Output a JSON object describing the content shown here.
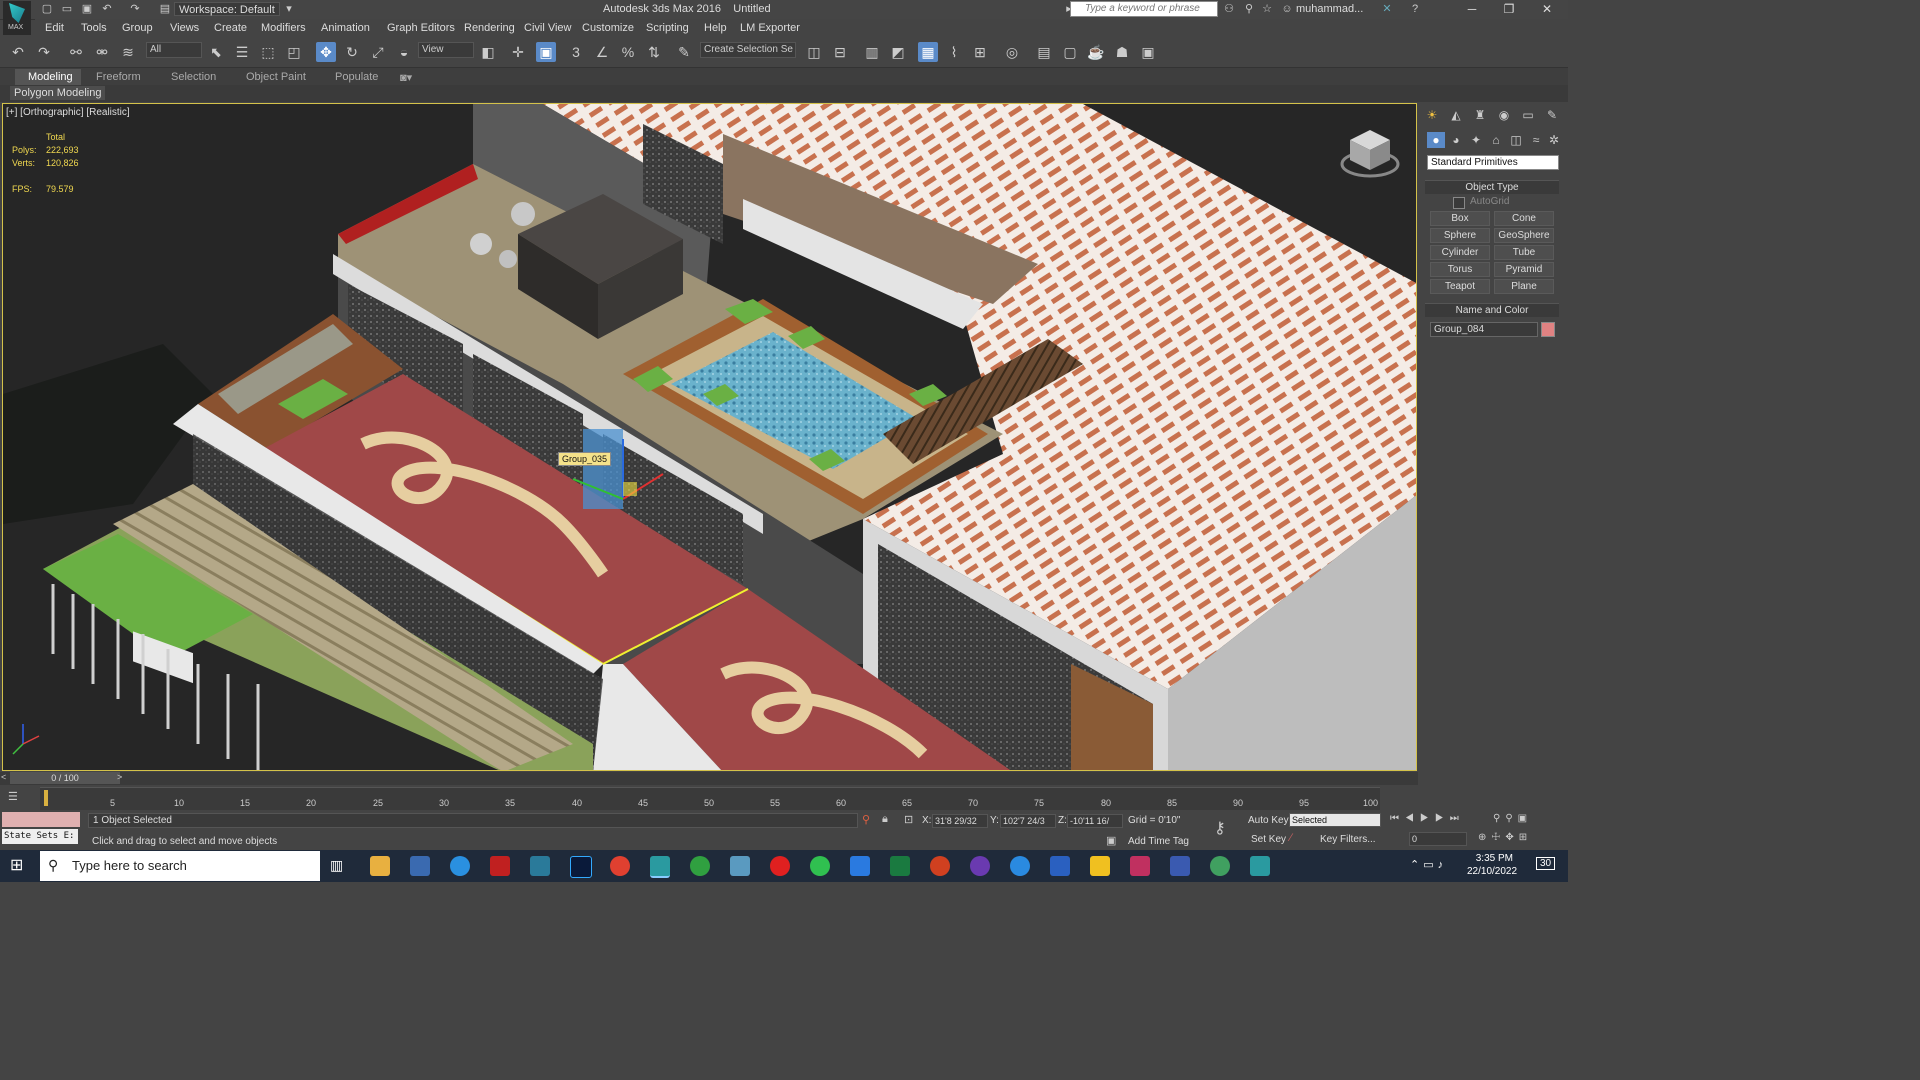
{
  "title_bar": {
    "workspace": "Workspace: Default",
    "app_title": "Autodesk 3ds Max 2016",
    "document": "Untitled",
    "search_placeholder": "Type a keyword or phrase",
    "user": "muhammad...",
    "logo_text": "MAX"
  },
  "menu": [
    "Edit",
    "Tools",
    "Group",
    "Views",
    "Create",
    "Modifiers",
    "Animation",
    "Graph Editors",
    "Rendering",
    "Civil View",
    "Customize",
    "Scripting",
    "Help",
    "LM Exporter"
  ],
  "toolbar": {
    "selection_filter": "All",
    "ref_coord": "View",
    "named_selection": "Create Selection Se",
    "snap_number": "3"
  },
  "ribbon": {
    "tabs": [
      "Modeling",
      "Freeform",
      "Selection",
      "Object Paint",
      "Populate"
    ],
    "active_tab": "Modeling",
    "panel_label": "Polygon Modeling"
  },
  "viewport": {
    "label": "[+] [Orthographic] [Realistic]",
    "stats_header": "Total",
    "polys_label": "Polys:",
    "polys_value": "222,693",
    "verts_label": "Verts:",
    "verts_value": "120,826",
    "fps_label": "FPS:",
    "fps_value": "79.579",
    "tooltip": "Group_035"
  },
  "command_panel": {
    "dropdown": "Standard Primitives",
    "object_type_header": "Object Type",
    "autogrid": "AutoGrid",
    "buttons": [
      "Box",
      "Cone",
      "Sphere",
      "GeoSphere",
      "Cylinder",
      "Tube",
      "Torus",
      "Pyramid",
      "Teapot",
      "Plane"
    ],
    "name_color_header": "Name and Color",
    "object_name": "Group_084",
    "object_color": "#e08282"
  },
  "timeline": {
    "slider": "0 / 100",
    "ticks": [
      "5",
      "10",
      "15",
      "20",
      "25",
      "30",
      "35",
      "40",
      "45",
      "50",
      "55",
      "60",
      "65",
      "70",
      "75",
      "80",
      "85",
      "90",
      "95",
      "100"
    ]
  },
  "status": {
    "state_sets": "State Sets E:",
    "selection": "1 Object Selected",
    "prompt": "Click and drag to select and move objects",
    "x_label": "X:",
    "x_value": "31'8 29/32",
    "y_label": "Y:",
    "y_value": "102'7 24/3",
    "z_label": "Z:",
    "z_value": "-10'11 16/",
    "grid": "Grid = 0'10\"",
    "add_time_tag": "Add Time Tag",
    "auto_key": "Auto Key",
    "set_key": "Set Key",
    "key_mode": "Selected",
    "key_filters": "Key Filters...",
    "frame": "0"
  },
  "taskbar": {
    "search_placeholder": "Type here to search",
    "time": "3:35 PM",
    "date": "22/10/2022",
    "notifications": "30"
  }
}
